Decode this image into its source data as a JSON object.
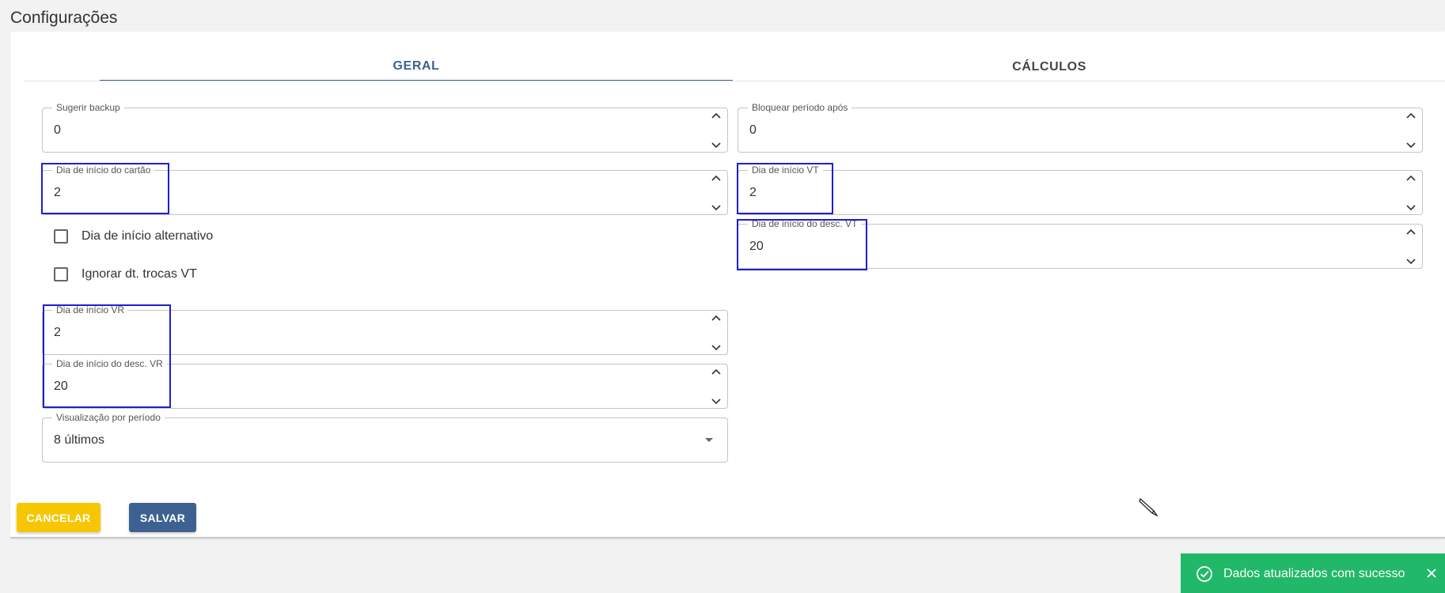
{
  "page": {
    "title": "Configurações"
  },
  "tabs": [
    {
      "label": "GERAL",
      "active": true
    },
    {
      "label": "CÁLCULOS",
      "active": false
    }
  ],
  "left": {
    "sugerir_backup": {
      "label": "Sugerir backup",
      "value": "0"
    },
    "dia_inicio_cartao": {
      "label": "Dia de início do cartão",
      "value": "2"
    },
    "dia_inicio_alternativo": {
      "label": "Dia de início alternativo",
      "checked": false
    },
    "ignorar_dt_trocas_vt": {
      "label": "Ignorar dt. trocas VT",
      "checked": false
    },
    "dia_inicio_vr": {
      "label": "Dia de início VR",
      "value": "2"
    },
    "dia_inicio_desc_vr": {
      "label": "Dia de início do desc. VR",
      "value": "20"
    },
    "visualizacao_periodo": {
      "label": "Visualização por período",
      "value": "8 últimos"
    }
  },
  "right": {
    "bloquear_periodo": {
      "label": "Bloquear período após",
      "value": "0"
    },
    "dia_inicio_vt": {
      "label": "Dia de início VT",
      "value": "2"
    },
    "dia_inicio_desc_vt": {
      "label": "Dia de início do desc. VT",
      "value": "20"
    }
  },
  "buttons": {
    "cancel": "CANCELAR",
    "save": "SALVAR"
  },
  "toast": {
    "message": "Dados atualizados com sucesso",
    "icon": "check-circle-icon"
  },
  "colors": {
    "primary": "#3d6191",
    "cancel": "#f6c700",
    "toast": "#21b869",
    "highlight": "#1f1fd1"
  }
}
